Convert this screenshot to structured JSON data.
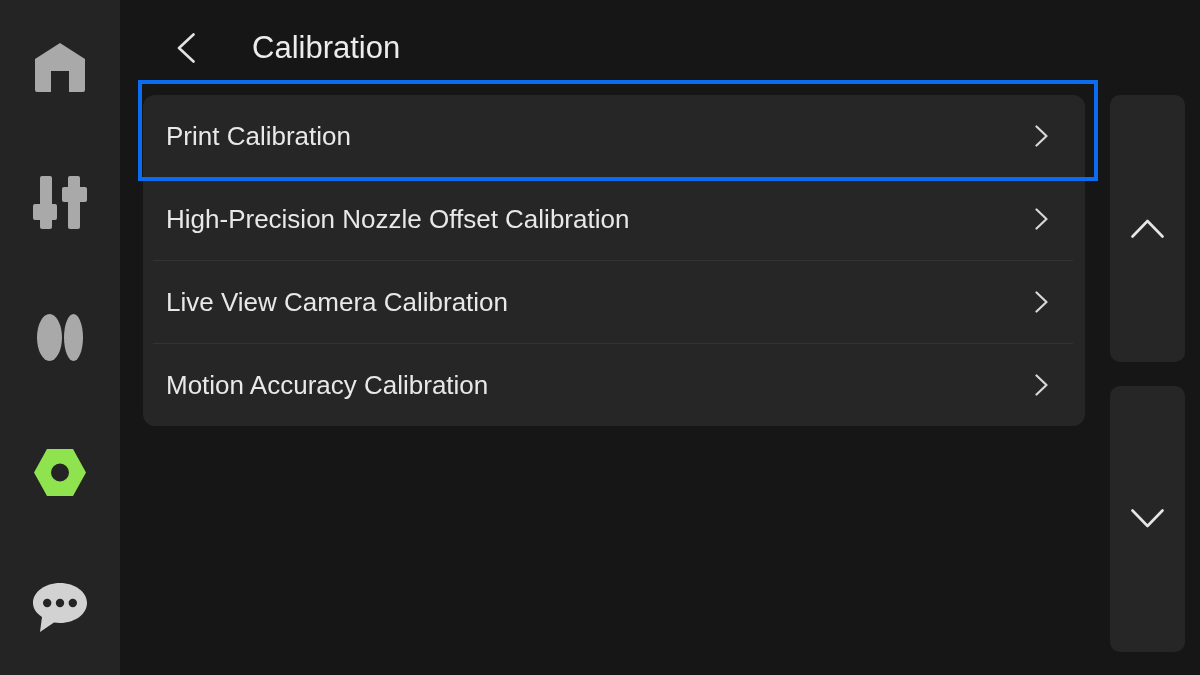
{
  "sidebar": {
    "items": [
      {
        "kind": "home",
        "selected": false
      },
      {
        "kind": "controls",
        "selected": false
      },
      {
        "kind": "filament",
        "selected": false
      },
      {
        "kind": "settings",
        "selected": true
      },
      {
        "kind": "messages",
        "selected": false
      }
    ]
  },
  "header": {
    "title": "Calibration"
  },
  "menu": {
    "items": [
      {
        "label": "Print Calibration",
        "focused": true
      },
      {
        "label": "High-Precision Nozzle Offset Calibration",
        "focused": false
      },
      {
        "label": "Live View Camera Calibration",
        "focused": false
      },
      {
        "label": "Motion Accuracy Calibration",
        "focused": false
      }
    ]
  }
}
